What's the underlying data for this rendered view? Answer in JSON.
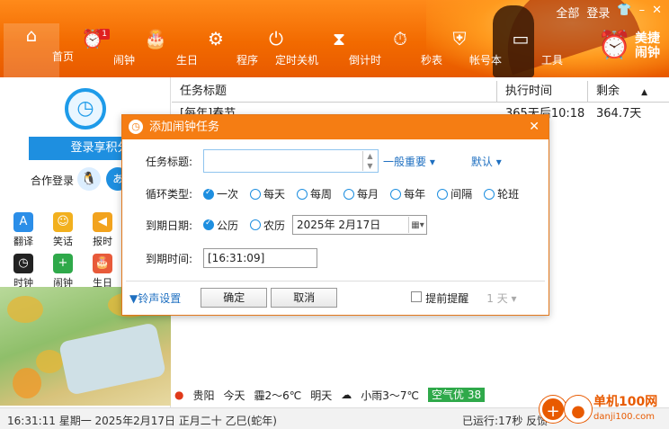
{
  "header": {
    "links": [
      "全部",
      "登录"
    ],
    "nav": [
      {
        "label": "首页",
        "icon": "home-icon",
        "glyph": "⌂",
        "active": true
      },
      {
        "label": "闹钟",
        "icon": "alarm-clock-icon",
        "glyph": "⏰",
        "badge": "1"
      },
      {
        "label": "生日",
        "icon": "birthday-cake-icon",
        "glyph": "🎂"
      },
      {
        "label": "程序",
        "icon": "gear-icon",
        "glyph": "⚙"
      },
      {
        "label": "定时关机",
        "icon": "power-icon",
        "glyph": "⏻"
      },
      {
        "label": "倒计时",
        "icon": "hourglass-icon",
        "glyph": "⧗"
      },
      {
        "label": "秒表",
        "icon": "stopwatch-icon",
        "glyph": "⏱"
      },
      {
        "label": "帐号本",
        "icon": "shield-icon",
        "glyph": "⛨"
      },
      {
        "label": "工具",
        "icon": "monitor-icon",
        "glyph": "▭"
      }
    ],
    "brand": "美捷\n闹钟",
    "brand_line1": "美捷",
    "brand_line2": "闹钟"
  },
  "sidebar": {
    "login_button": "登录享积分",
    "coop_label": "合作登录",
    "tools": [
      {
        "label": "翻译",
        "icon": "translate-icon",
        "glyph": "A",
        "color": "#2b8ee8"
      },
      {
        "label": "笑话",
        "icon": "smiley-icon",
        "glyph": "☺",
        "color": "#f2b01e"
      },
      {
        "label": "报时",
        "icon": "speaker-icon",
        "glyph": "◀",
        "color": "#f2a31e"
      },
      {
        "label": "",
        "icon": "",
        "glyph": "",
        "color": "#ffffff"
      },
      {
        "label": "时钟",
        "icon": "clock-icon",
        "glyph": "◷",
        "color": "#222222"
      },
      {
        "label": "闹钟",
        "icon": "alarm-add-icon",
        "glyph": "+",
        "color": "#2fa94a"
      },
      {
        "label": "生日",
        "icon": "birthday-cake-icon",
        "glyph": "🎂",
        "color": "#e85a3a"
      }
    ]
  },
  "list": {
    "columns": [
      "任务标题",
      "执行时间",
      "剩余"
    ],
    "rows": [
      {
        "title": "[每年]春节",
        "time": "365天后10:18",
        "remain": "364.7天"
      }
    ]
  },
  "weather": {
    "city": "贵阳",
    "today_label": "今天",
    "today": "霾2～6℃",
    "tomorrow_label": "明天",
    "tomorrow": "小雨3～7℃",
    "aqi": "空气优 38"
  },
  "status": {
    "datetime": "16:31:11 星期一 2025年2月17日 正月二十 乙巳(蛇年)",
    "running": "已运行:17秒",
    "feedback": "反馈"
  },
  "dialog": {
    "title": "添加闹钟任务",
    "task_title_label": "任务标题:",
    "task_title_value": "",
    "importance": "一般重要",
    "sound": "默认",
    "cycle_label": "循环类型:",
    "cycle_options": [
      "一次",
      "每天",
      "每周",
      "每月",
      "每年",
      "间隔",
      "轮班"
    ],
    "cycle_selected": "一次",
    "date_label": "到期日期:",
    "calendar_options": [
      "公历",
      "农历"
    ],
    "date_value": "2025年  2月17日",
    "time_label": "到期时间:",
    "time_value": "[16:31:09]",
    "ringtone_link": "▼铃声设置",
    "ok": "确定",
    "cancel": "取消",
    "advance_label": "提前提醒",
    "advance_value": "1 天"
  },
  "watermark": {
    "text": "单机100网",
    "sub": "danji100.com"
  }
}
